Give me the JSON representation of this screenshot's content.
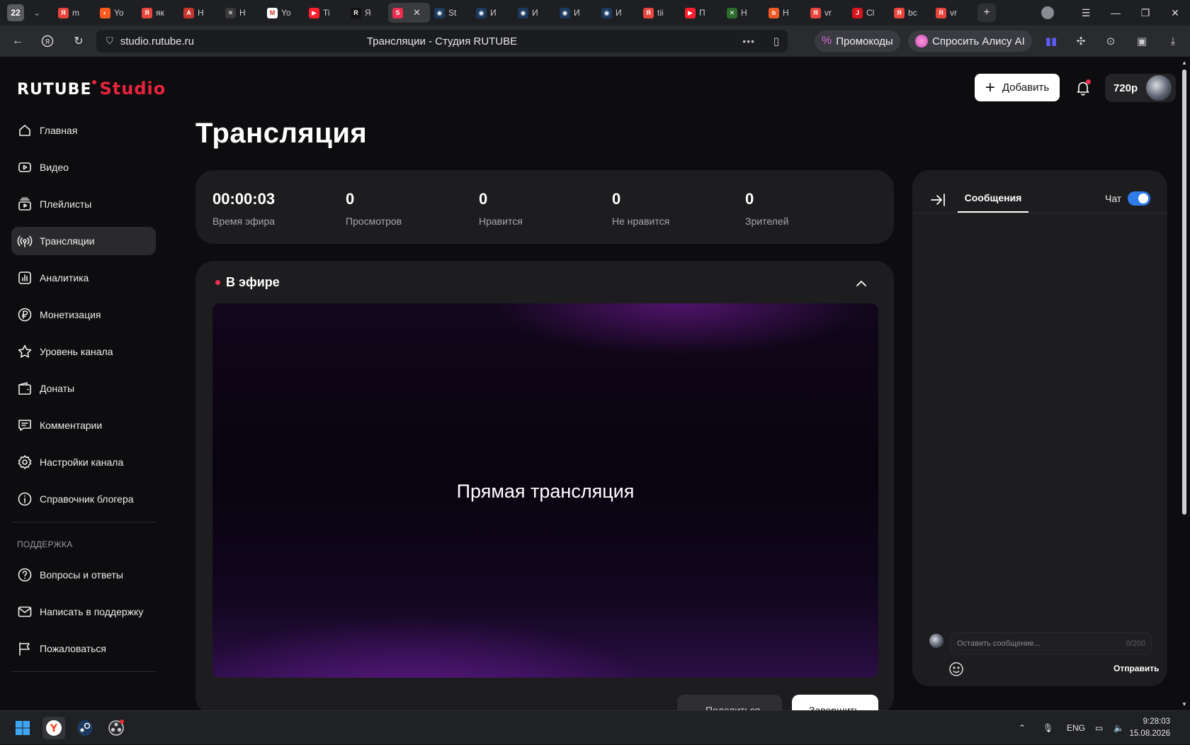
{
  "browser": {
    "tab_count": "22",
    "tabs": [
      {
        "label": "m",
        "color": "#e8463c",
        "glyph": "Я"
      },
      {
        "label": "Yo",
        "color": "#ff5a1f",
        "glyph": "◐"
      },
      {
        "label": "як",
        "color": "#e8463c",
        "glyph": "Я"
      },
      {
        "label": "H",
        "color": "#c8342b",
        "glyph": "A"
      },
      {
        "label": "H",
        "color": "#3a3a3a",
        "glyph": "✕"
      },
      {
        "label": "Yo",
        "color": "#ffffff",
        "glyph": "M"
      },
      {
        "label": "Ti",
        "color": "#ff1f2d",
        "glyph": "▶"
      },
      {
        "label": "Я",
        "color": "#121212",
        "glyph": "R"
      },
      {
        "label": "",
        "color": "#ef2d4f",
        "glyph": "S",
        "active": true
      },
      {
        "label": "St",
        "color": "#1b3a5e",
        "glyph": "◉"
      },
      {
        "label": "И",
        "color": "#1b3a5e",
        "glyph": "◉"
      },
      {
        "label": "И",
        "color": "#1b3a5e",
        "glyph": "◉"
      },
      {
        "label": "И",
        "color": "#1b3a5e",
        "glyph": "◉"
      },
      {
        "label": "И",
        "color": "#1b3a5e",
        "glyph": "◉"
      },
      {
        "label": "tii",
        "color": "#e8463c",
        "glyph": "Я"
      },
      {
        "label": "П",
        "color": "#ff1f2d",
        "glyph": "▶"
      },
      {
        "label": "H",
        "color": "#2d6b2d",
        "glyph": "✕"
      },
      {
        "label": "H",
        "color": "#f05a28",
        "glyph": "b"
      },
      {
        "label": "vr",
        "color": "#e8463c",
        "glyph": "Я"
      },
      {
        "label": "Cl",
        "color": "#d7151c",
        "glyph": "J"
      },
      {
        "label": "bc",
        "color": "#e8463c",
        "glyph": "Я"
      },
      {
        "label": "vr",
        "color": "#e8463c",
        "glyph": "Я"
      }
    ],
    "url": "studio.rutube.ru",
    "page_title": "Трансляции - Студия RUTUBE",
    "promo_label": "Промокоды",
    "alice_label": "Спросить Алису AI"
  },
  "studio": {
    "logo_main": "RUTUBE",
    "logo_studio": "Studio",
    "add_button": "Добавить",
    "quality": "720p"
  },
  "sidebar": {
    "items": [
      {
        "label": "Главная",
        "icon": "home-icon"
      },
      {
        "label": "Видео",
        "icon": "video-icon"
      },
      {
        "label": "Плейлисты",
        "icon": "playlist-icon"
      },
      {
        "label": "Трансляции",
        "icon": "broadcast-icon",
        "active": true
      },
      {
        "label": "Аналитика",
        "icon": "analytics-icon"
      },
      {
        "label": "Монетизация",
        "icon": "ruble-icon"
      },
      {
        "label": "Уровень канала",
        "icon": "star-icon"
      },
      {
        "label": "Донаты",
        "icon": "wallet-icon"
      },
      {
        "label": "Комментарии",
        "icon": "comment-icon"
      },
      {
        "label": "Настройки канала",
        "icon": "gear-icon"
      },
      {
        "label": "Справочник блогера",
        "icon": "info-icon"
      }
    ],
    "support_heading": "ПОДДЕРЖКА",
    "support_items": [
      {
        "label": "Вопросы и ответы",
        "icon": "question-icon"
      },
      {
        "label": "Написать в поддержку",
        "icon": "mail-icon"
      },
      {
        "label": "Пожаловаться",
        "icon": "flag-icon"
      }
    ]
  },
  "main": {
    "title": "Трансляция",
    "stats": [
      {
        "value": "00:00:03",
        "label": "Время эфира"
      },
      {
        "value": "0",
        "label": "Просмотров"
      },
      {
        "value": "0",
        "label": "Нравится"
      },
      {
        "value": "0",
        "label": "Не нравится"
      },
      {
        "value": "0",
        "label": "Зрителей"
      }
    ],
    "live_label": "В эфире",
    "player_label": "Прямая трансляция",
    "share_button": "Поделиться",
    "end_button": "Завершить"
  },
  "chat": {
    "tab_label": "Сообщения",
    "toggle_label": "Чат",
    "toggle_on": true,
    "input_placeholder": "Оставить сообщение...",
    "char_count": "0/200",
    "send_label": "Отправить"
  },
  "taskbar": {
    "lang": "ENG",
    "time": "9:28:03",
    "date": "15.08.2026"
  },
  "colors": {
    "accent_red": "#ef2d4f",
    "toggle_blue": "#2f7bea",
    "panel_bg": "#1d1d20",
    "page_bg": "#0d0d0f"
  }
}
